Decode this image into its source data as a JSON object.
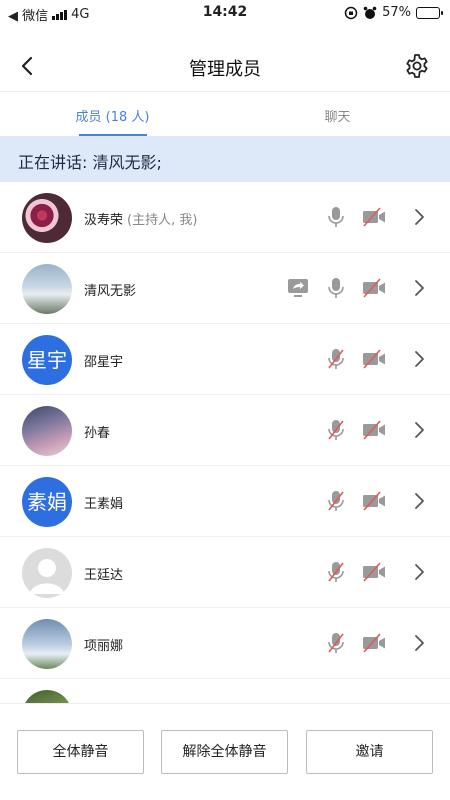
{
  "status_bar": {
    "back_app": "◀ 微信",
    "network": "4G",
    "time": "14:42",
    "battery": "57%",
    "battery_level": 0.57
  },
  "header": {
    "title": "管理成员"
  },
  "tabs": [
    {
      "label": "成员 (18 人)",
      "active": true
    },
    {
      "label": "聊天",
      "active": false
    }
  ],
  "speaking_banner": "正在讲话: 清风无影;",
  "members": [
    {
      "name": "汲寿荣",
      "role": "(主持人, 我)",
      "avatar_text": "",
      "avatar": "photo1",
      "sharing": false,
      "mic_muted": false,
      "video_off": true
    },
    {
      "name": "清风无影",
      "role": "",
      "avatar_text": "",
      "avatar": "photo2",
      "sharing": true,
      "mic_muted": false,
      "video_off": true
    },
    {
      "name": "邵星宇",
      "role": "",
      "avatar_text": "星宇",
      "avatar": "text",
      "sharing": false,
      "mic_muted": true,
      "video_off": true
    },
    {
      "name": "孙春",
      "role": "",
      "avatar_text": "",
      "avatar": "photo3",
      "sharing": false,
      "mic_muted": true,
      "video_off": true
    },
    {
      "name": "王素娟",
      "role": "",
      "avatar_text": "素娟",
      "avatar": "text",
      "sharing": false,
      "mic_muted": true,
      "video_off": true
    },
    {
      "name": "王廷达",
      "role": "",
      "avatar_text": "",
      "avatar": "placeholder",
      "sharing": false,
      "mic_muted": true,
      "video_off": true
    },
    {
      "name": "项丽娜",
      "role": "",
      "avatar_text": "",
      "avatar": "photo4",
      "sharing": false,
      "mic_muted": true,
      "video_off": true
    },
    {
      "name": "",
      "role": "",
      "avatar_text": "",
      "avatar": "photo5",
      "sharing": false,
      "mic_muted": true,
      "video_off": true
    }
  ],
  "actions": {
    "mute_all": "全体静音",
    "unmute_all": "解除全体静音",
    "invite": "邀请"
  },
  "colors": {
    "accent": "#4a82d6",
    "banner_bg": "#dde9f8",
    "avatar_blue": "#2d6fe0",
    "icon_gray": "#9a9a9a",
    "muted_red": "#e05a5a"
  }
}
